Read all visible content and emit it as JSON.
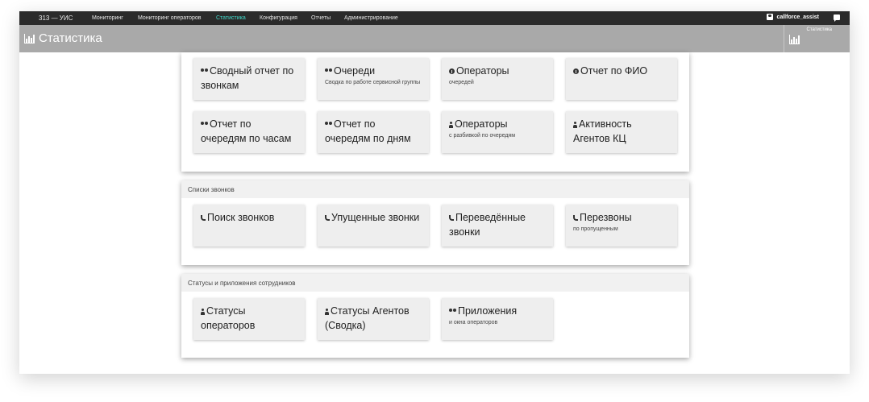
{
  "nav": {
    "brand": "313 — УИС",
    "items": [
      "Мониторинг",
      "Мониторинг операторов",
      "Статистика",
      "Конфигурация",
      "Отчеты",
      "Администрирование"
    ],
    "active_index": 2,
    "user": "callforce_assist",
    "accent_color": "#40d7c8"
  },
  "header": {
    "title": "Статистика",
    "side_label": "Статистика",
    "icon": "bar-chart-icon"
  },
  "sections": {
    "reports": {
      "tiles": [
        {
          "icon": "users-icon",
          "title": "Сводный отчет по звонкам",
          "sub": ""
        },
        {
          "icon": "users-icon",
          "title": "Очереди",
          "sub": "Сводка по работе сервисной группы"
        },
        {
          "icon": "info-icon",
          "title": "Операторы",
          "sub": "очередей"
        },
        {
          "icon": "info-icon",
          "title": "Отчет по ФИО",
          "sub": ""
        },
        {
          "icon": "users-icon",
          "title": "Отчет по очередям по часам",
          "sub": ""
        },
        {
          "icon": "users-icon",
          "title": "Отчет по очередям по дням",
          "sub": ""
        },
        {
          "icon": "user-icon",
          "title": "Операторы",
          "sub": "с разбивкой по очередям"
        },
        {
          "icon": "user-icon",
          "title": "Активность Агентов КЦ",
          "sub": ""
        }
      ]
    },
    "calls": {
      "heading": "Списки звонков",
      "tiles": [
        {
          "icon": "phone-icon",
          "title": "Поиск звонков",
          "sub": ""
        },
        {
          "icon": "phone-icon",
          "title": "Упущенные звонки",
          "sub": ""
        },
        {
          "icon": "phone-icon",
          "title": "Переведённые звонки",
          "sub": ""
        },
        {
          "icon": "phone-icon",
          "title": "Перезвоны",
          "sub": "по пропущенным"
        }
      ]
    },
    "statuses": {
      "heading": "Статусы и приложения сотрудников",
      "tiles": [
        {
          "icon": "user-icon",
          "title": "Статусы операторов",
          "sub": ""
        },
        {
          "icon": "user-icon",
          "title": "Статусы Агентов (Сводка)",
          "sub": ""
        },
        {
          "icon": "users-icon",
          "title": "Приложения",
          "sub": "и окна операторов"
        }
      ]
    }
  }
}
